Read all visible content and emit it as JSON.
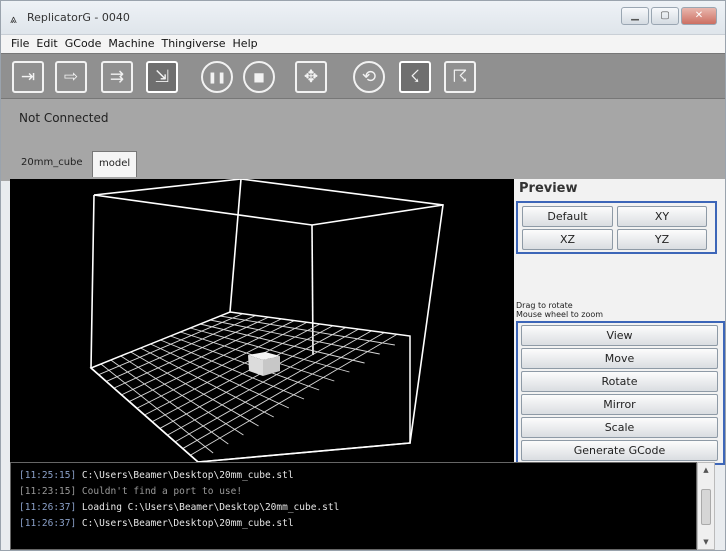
{
  "window": {
    "title": "ReplicatorG - 0040",
    "app_icon": "replicatorg-logo-icon",
    "controls": [
      "minimize-icon",
      "maximize-icon",
      "close-icon"
    ]
  },
  "menu": {
    "items": [
      "File",
      "Edit",
      "GCode",
      "Machine",
      "Thingiverse",
      "Help"
    ]
  },
  "toolbar": {
    "buttons": [
      {
        "name": "connect-icon",
        "glyph": "⇥",
        "state": "normal"
      },
      {
        "name": "build-icon",
        "glyph": "⇨",
        "state": "normal"
      },
      {
        "name": "build-to-file-icon",
        "glyph": "⇉",
        "state": "normal"
      },
      {
        "name": "upload-icon",
        "glyph": "⇲",
        "state": "active"
      },
      {
        "name": "pause-icon",
        "glyph": "❚❚",
        "state": "normal"
      },
      {
        "name": "stop-icon",
        "glyph": "■",
        "state": "normal"
      },
      {
        "name": "control-panel-icon",
        "glyph": "✥",
        "state": "normal"
      },
      {
        "name": "reset-icon",
        "glyph": "⟲",
        "state": "normal"
      },
      {
        "name": "generate-gcode-icon",
        "glyph": "☇",
        "state": "active"
      },
      {
        "name": "disconnect-icon",
        "glyph": "☈",
        "state": "normal"
      }
    ]
  },
  "status": {
    "connection": "Not Connected"
  },
  "tabs": [
    "20mm_cube",
    "model"
  ],
  "preview": {
    "title": "Preview",
    "buttons": [
      "Default",
      "XY",
      "XZ",
      "YZ"
    ]
  },
  "hints": {
    "rotate": "Drag to rotate",
    "zoom": "Mouse wheel to zoom"
  },
  "actions": [
    "View",
    "Move",
    "Rotate",
    "Mirror",
    "Scale",
    "Generate GCode"
  ],
  "console": {
    "lines": [
      {
        "time": "[11:25:15]",
        "text": " C:\\Users\\Beamer\\Desktop\\20mm_cube.stl",
        "dim": false
      },
      {
        "time": "[11:23:15]",
        "text": " Couldn't find a port to use!",
        "dim": true
      },
      {
        "time": "[11:26:37]",
        "text": " Loading C:\\Users\\Beamer\\Desktop\\20mm_cube.stl",
        "dim": false
      },
      {
        "time": "[11:26:37]",
        "text": " C:\\Users\\Beamer\\Desktop\\20mm_cube.stl",
        "dim": false
      }
    ]
  },
  "colors": {
    "highlight_border": "#3d66b8",
    "toolbar_bg": "#909090",
    "viewport_bg": "#000000",
    "wireframe": "#ffffff"
  }
}
